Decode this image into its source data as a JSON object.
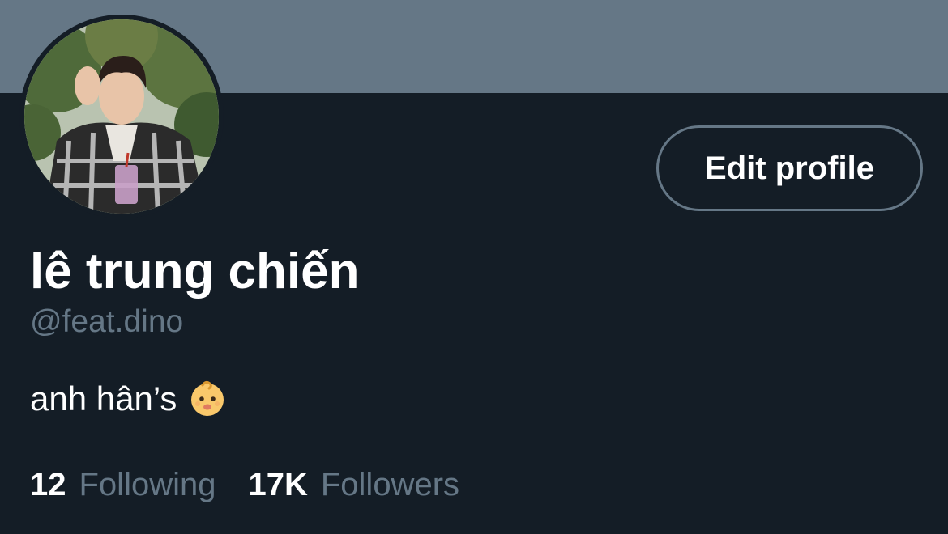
{
  "profile": {
    "display_name": "lê trung chiến",
    "handle": "@feat.dino",
    "bio": "anh hân’s",
    "bio_emoji": "baby-emoji",
    "avatar": "profile-photo"
  },
  "actions": {
    "edit_profile_label": "Edit profile"
  },
  "stats": {
    "following_count": "12",
    "following_label": "Following",
    "followers_count": "17K",
    "followers_label": "Followers"
  },
  "colors": {
    "background": "#141d26",
    "banner": "#657786",
    "secondary_text": "#657786",
    "primary_text": "#ffffff"
  }
}
